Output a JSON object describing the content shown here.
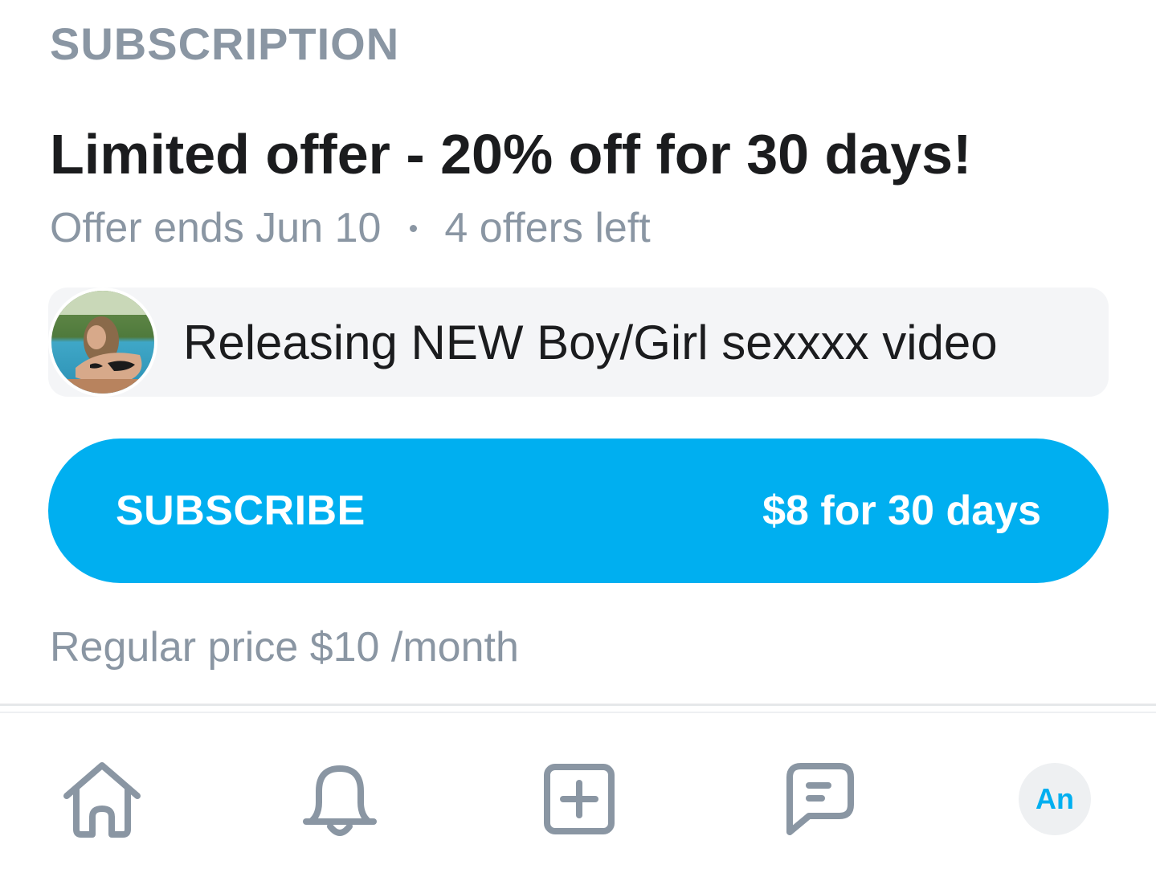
{
  "section": {
    "label": "SUBSCRIPTION"
  },
  "offer": {
    "title": "Limited offer - 20% off for 30 days!",
    "ends": "Offer ends Jun 10",
    "remaining": "4 offers left"
  },
  "message": {
    "text": "Releasing NEW Boy/Girl sexxxx video"
  },
  "subscribe_button": {
    "label": "SUBSCRIBE",
    "price": "$8 for 30 days"
  },
  "regular_price": "Regular price $10 /month",
  "bottom_nav": {
    "items": [
      {
        "icon": "home-icon"
      },
      {
        "icon": "bell-icon"
      },
      {
        "icon": "plus-square-icon"
      },
      {
        "icon": "messages-icon"
      }
    ],
    "profile_initials": "An"
  },
  "colors": {
    "accent": "#00aff0",
    "muted_text": "#8a96a3",
    "primary_text": "#1b1c1e",
    "message_bg": "#f4f5f7"
  }
}
